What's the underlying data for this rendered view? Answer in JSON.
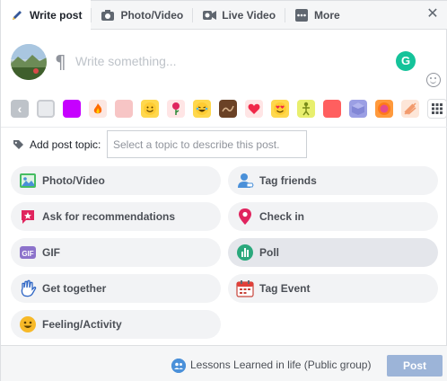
{
  "tabs": [
    {
      "label": "Write post",
      "icon": "pencil-icon",
      "active": true
    },
    {
      "label": "Photo/Video",
      "icon": "camera-icon"
    },
    {
      "label": "Live Video",
      "icon": "video-camera-icon"
    },
    {
      "label": "More",
      "icon": "ellipsis-icon"
    }
  ],
  "composer": {
    "placeholder": "Write something...",
    "grammarly_letter": "G"
  },
  "palette": {
    "colors": [
      "#e9ebee",
      "#c600ff",
      "#fce7e2",
      "#f7b9b9",
      "#ffd84d",
      "#ffe5e5",
      "#ffd84d",
      "#6b4226",
      "#ff7a93",
      "#ffd84d",
      "#e8ef6e",
      "#ff5f5f",
      "#9b9fe4",
      "#ff9a3c",
      "#f7c9a8"
    ],
    "more_icon": "grid-icon"
  },
  "topic": {
    "label": "Add post topic:",
    "placeholder": "Select a topic to describe this post."
  },
  "actions": [
    {
      "label": "Photo/Video",
      "icon": "photo-icon"
    },
    {
      "label": "Tag friends",
      "icon": "tag-friends-icon"
    },
    {
      "label": "Ask for recommendations",
      "icon": "recommendation-icon"
    },
    {
      "label": "Check in",
      "icon": "location-pin-icon"
    },
    {
      "label": "GIF",
      "icon": "gif-icon"
    },
    {
      "label": "Poll",
      "icon": "poll-icon"
    },
    {
      "label": "Get together",
      "icon": "waving-hand-icon"
    },
    {
      "label": "Tag Event",
      "icon": "calendar-icon"
    },
    {
      "label": "Feeling/Activity",
      "icon": "smiley-icon"
    }
  ],
  "footer": {
    "group_name": "Lessons Learned in life",
    "privacy": "(Public group)",
    "post_label": "Post"
  },
  "colors": {
    "accent": "#4267b2",
    "post_disabled": "#9cb4d8",
    "pill_bg": "#f2f3f5"
  }
}
